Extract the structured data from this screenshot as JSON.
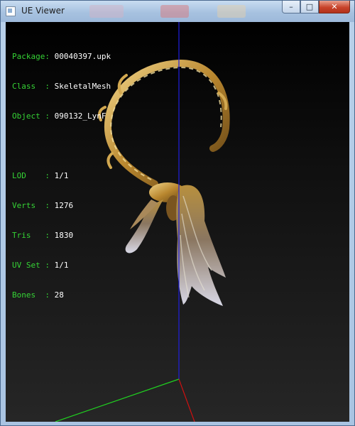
{
  "window": {
    "title": "UE Viewer",
    "controls": {
      "minimize": "–",
      "maximize": "□",
      "close": "✕"
    }
  },
  "info": {
    "package": {
      "label": "Package:",
      "value": "00040397.upk"
    },
    "class": {
      "label": "Class  :",
      "value": "SkeletalMesh"
    },
    "object": {
      "label": "Object :",
      "value": "090132_LynF"
    },
    "lod": {
      "label": "LOD    :",
      "value": "1/1"
    },
    "verts": {
      "label": "Verts  :",
      "value": "1276"
    },
    "tris": {
      "label": "Tris   :",
      "value": "1830"
    },
    "uvset": {
      "label": "UV Set :",
      "value": "1/1"
    },
    "bones": {
      "label": "Bones  :",
      "value": "28"
    }
  },
  "colors": {
    "label_green": "#35d335",
    "axis_x": "#d01010",
    "axis_y": "#20d020",
    "axis_z": "#2020e0",
    "gold": "#c9a24a"
  },
  "icons": {
    "app": "app-window-icon"
  }
}
